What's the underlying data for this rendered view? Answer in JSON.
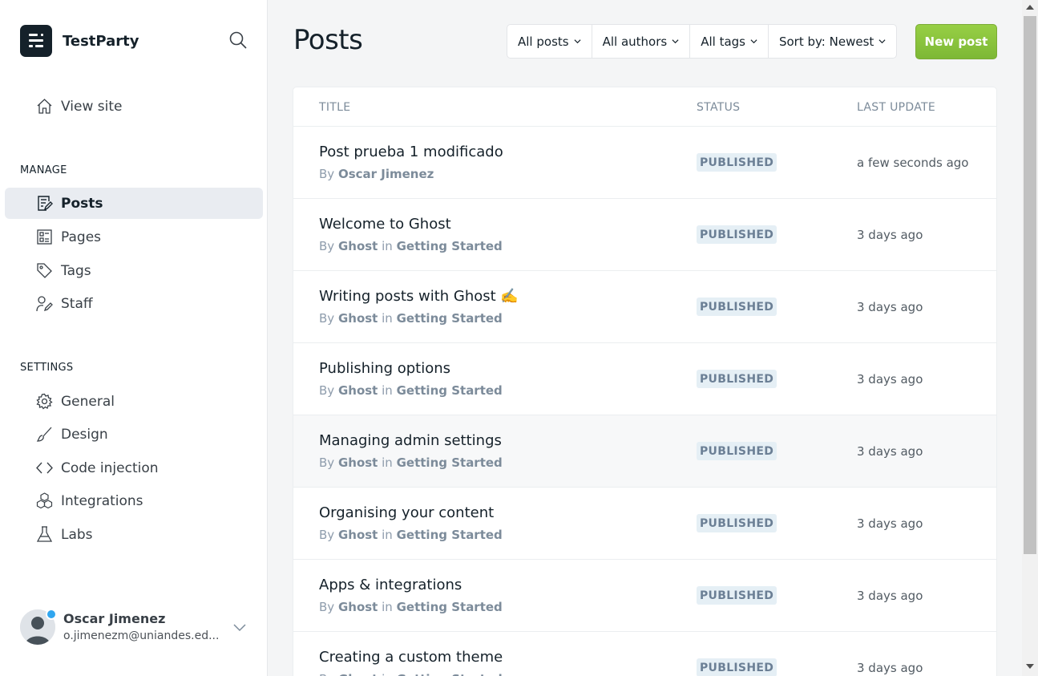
{
  "brand": {
    "name": "TestParty"
  },
  "sidebar": {
    "view_site": "View site",
    "manage_heading": "MANAGE",
    "manage_items": [
      {
        "label": "Posts",
        "icon": "posts-icon",
        "active": true
      },
      {
        "label": "Pages",
        "icon": "pages-icon"
      },
      {
        "label": "Tags",
        "icon": "tag-icon"
      },
      {
        "label": "Staff",
        "icon": "staff-icon"
      }
    ],
    "settings_heading": "SETTINGS",
    "settings_items": [
      {
        "label": "General",
        "icon": "gear-icon"
      },
      {
        "label": "Design",
        "icon": "brush-icon"
      },
      {
        "label": "Code injection",
        "icon": "code-icon"
      },
      {
        "label": "Integrations",
        "icon": "integrations-icon"
      },
      {
        "label": "Labs",
        "icon": "flask-icon"
      }
    ]
  },
  "user": {
    "name": "Oscar Jimenez",
    "email": "o.jimenezm@uniandes.ed..."
  },
  "header": {
    "title": "Posts",
    "filters": [
      "All posts",
      "All authors",
      "All tags",
      "Sort by: Newest"
    ],
    "new_post": "New post"
  },
  "table": {
    "columns": [
      "TITLE",
      "STATUS",
      "LAST UPDATE"
    ],
    "rows": [
      {
        "title": "Post prueba 1 modificado",
        "by": "By",
        "author": "Oscar Jimenez",
        "in": "",
        "tag": "",
        "status": "PUBLISHED",
        "updated": "a few seconds ago"
      },
      {
        "title": "Welcome to Ghost",
        "by": "By",
        "author": "Ghost",
        "in": "in",
        "tag": "Getting Started",
        "status": "PUBLISHED",
        "updated": "3 days ago"
      },
      {
        "title": "Writing posts with Ghost ✍️",
        "by": "By",
        "author": "Ghost",
        "in": "in",
        "tag": "Getting Started",
        "status": "PUBLISHED",
        "updated": "3 days ago"
      },
      {
        "title": "Publishing options",
        "by": "By",
        "author": "Ghost",
        "in": "in",
        "tag": "Getting Started",
        "status": "PUBLISHED",
        "updated": "3 days ago"
      },
      {
        "title": "Managing admin settings",
        "by": "By",
        "author": "Ghost",
        "in": "in",
        "tag": "Getting Started",
        "status": "PUBLISHED",
        "updated": "3 days ago"
      },
      {
        "title": "Organising your content",
        "by": "By",
        "author": "Ghost",
        "in": "in",
        "tag": "Getting Started",
        "status": "PUBLISHED",
        "updated": "3 days ago"
      },
      {
        "title": "Apps & integrations",
        "by": "By",
        "author": "Ghost",
        "in": "in",
        "tag": "Getting Started",
        "status": "PUBLISHED",
        "updated": "3 days ago"
      },
      {
        "title": "Creating a custom theme",
        "by": "By",
        "author": "Ghost",
        "in": "in",
        "tag": "Getting Started",
        "status": "PUBLISHED",
        "updated": "3 days ago"
      }
    ]
  },
  "colors": {
    "accent": "#8cc63f",
    "active_nav": "#e9ecf1",
    "badge_bg": "#e5eff5",
    "notification": "#30a6ef"
  }
}
